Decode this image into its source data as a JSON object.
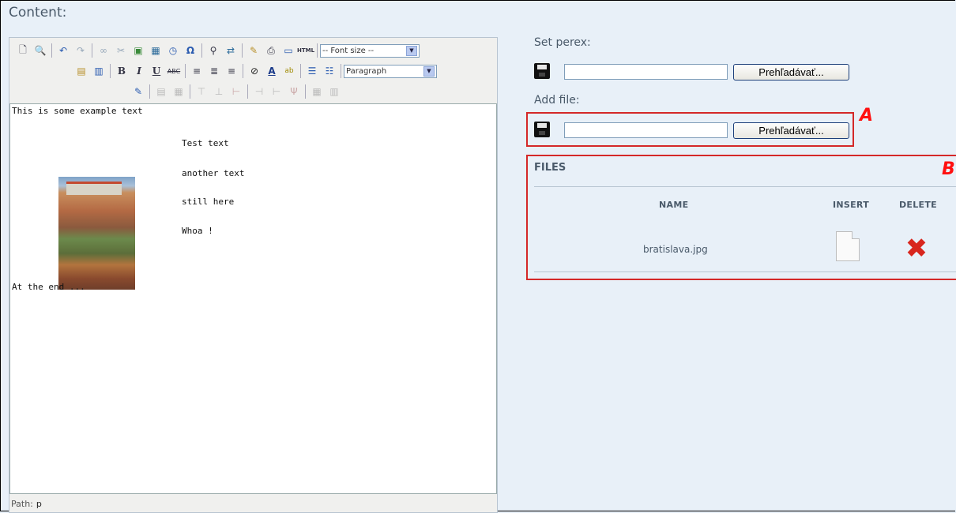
{
  "content_title": "Content:",
  "toolbar": {
    "font_size_select": "-- Font size --",
    "format_select": "Paragraph"
  },
  "editor": {
    "line1": "This is some example text",
    "col_texts": [
      "Test text",
      "another text",
      "still here",
      "Whoa !"
    ],
    "line_end": "At the end ...",
    "path_label": "Path:",
    "path_value": "p"
  },
  "perex": {
    "label": "Set perex:",
    "button": "Prehľadávať..."
  },
  "addfile": {
    "label": "Add file:",
    "button": "Prehľadávať...",
    "annotation": "A"
  },
  "files": {
    "title": "FILES",
    "annotation": "B",
    "headers": {
      "name": "NAME",
      "insert": "INSERT",
      "delete": "DELETE"
    },
    "rows": [
      {
        "name": "bratislava.jpg"
      }
    ]
  },
  "colors": {
    "annotation_red": "#d42828",
    "label_text": "#4a5a6a",
    "background": "#e8f0f8"
  }
}
